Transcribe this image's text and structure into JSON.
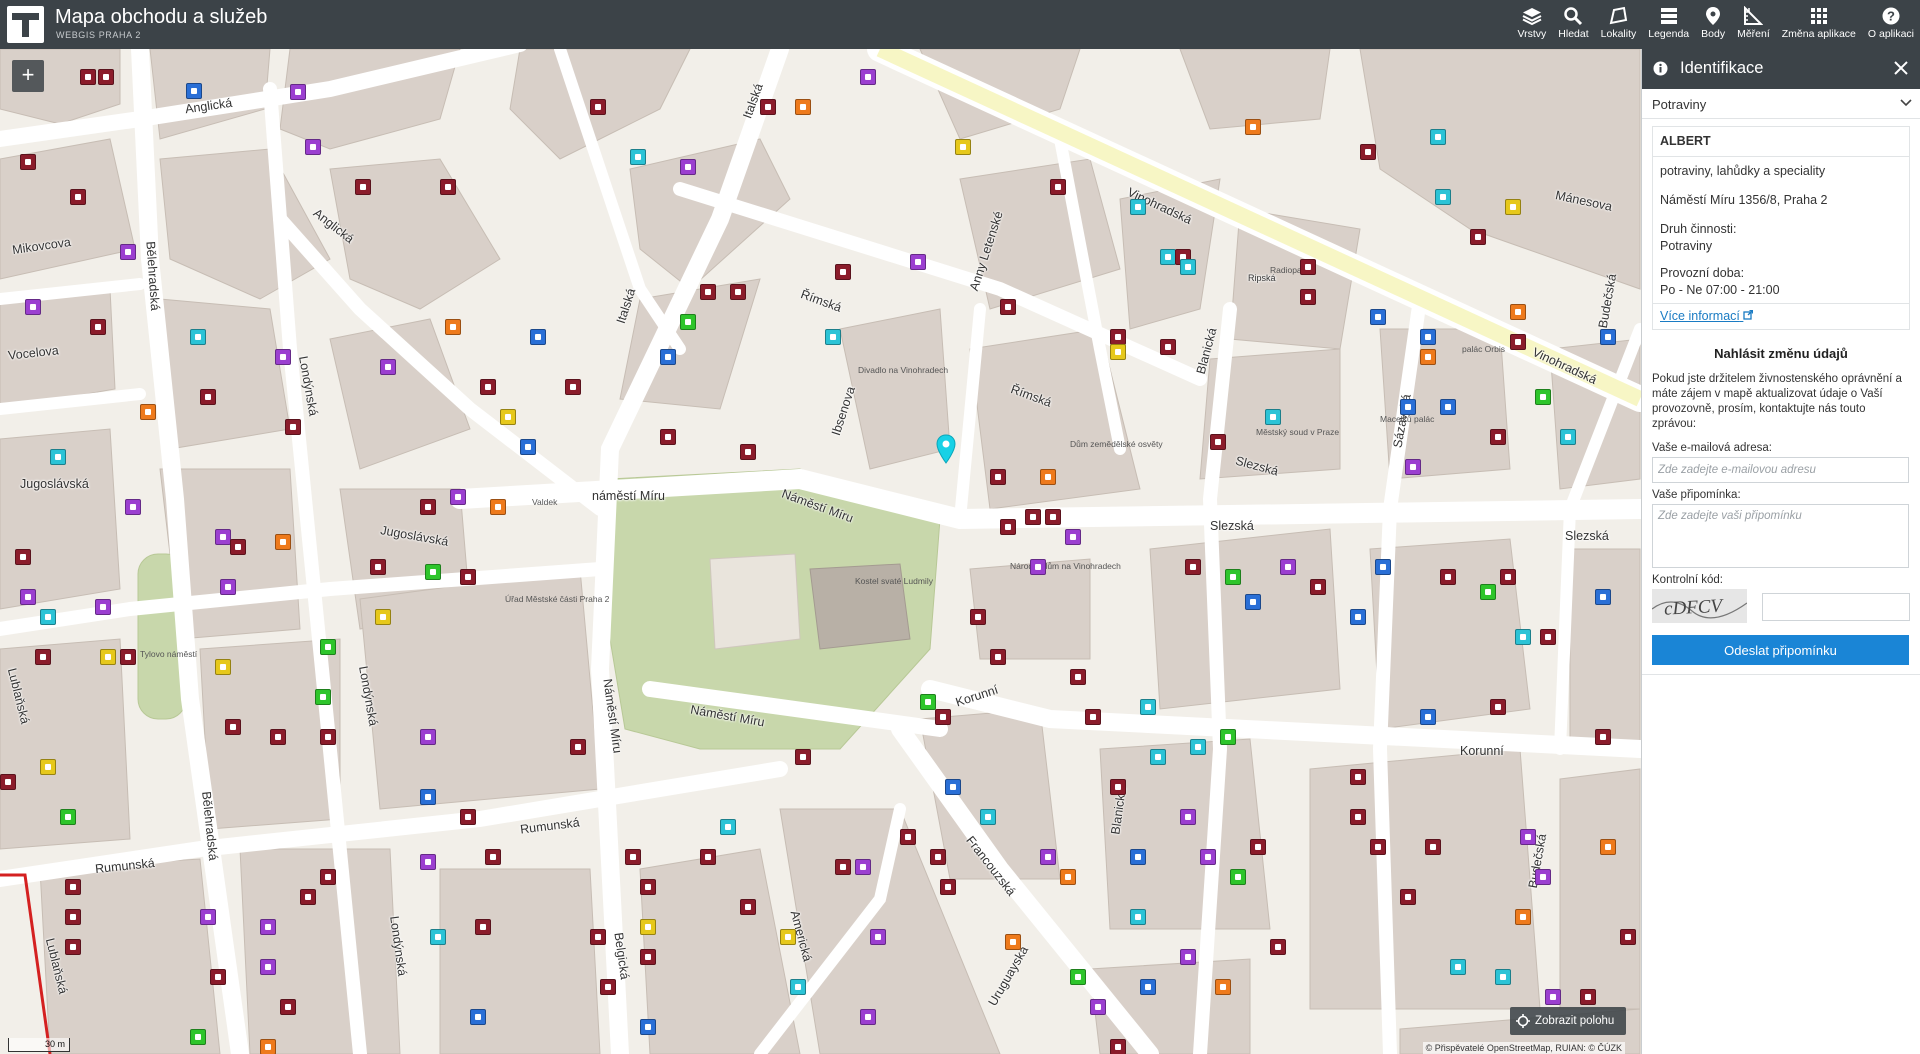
{
  "app": {
    "title": "Mapa obchodu a služeb",
    "subtitle": "WEBGIS PRAHA 2"
  },
  "toolbar": [
    {
      "label": "Vrstvy",
      "icon": "layers-icon"
    },
    {
      "label": "Hledat",
      "icon": "search-icon"
    },
    {
      "label": "Lokality",
      "icon": "area-icon"
    },
    {
      "label": "Legenda",
      "icon": "legend-icon"
    },
    {
      "label": "Body",
      "icon": "point-icon"
    },
    {
      "label": "Měření",
      "icon": "measure-icon"
    },
    {
      "label": "Změna aplikace",
      "icon": "apps-grid-icon"
    },
    {
      "label": "O aplikaci",
      "icon": "help-icon"
    }
  ],
  "map": {
    "zoom_in_label": "+",
    "locate_button": "Zobrazit polohu",
    "attribution": "© Přispěvatelé OpenStreetMap, RUIAN: © ČÚZK",
    "scale": "30 m",
    "street_labels": [
      "Anglická",
      "Anglická",
      "Italská",
      "Italská",
      "Mikovcova",
      "Vocelova",
      "Jugoslávská",
      "Jugoslávská",
      "Londýnská",
      "Londýnská",
      "Londýnská",
      "Bělehradská",
      "Bělehradská",
      "Římská",
      "Římská",
      "Ibsenova",
      "Anny Letenské",
      "Vinohradská",
      "Vinohradská",
      "Blanická",
      "Blanická",
      "Sázavská",
      "Slezská",
      "Slezská",
      "Slezská",
      "náměstí Míru",
      "Náměstí Míru",
      "Náměstí Míru",
      "Náměstí Míru",
      "Korunní",
      "Korunní",
      "Rumunská",
      "Rumunská",
      "Francouzská",
      "Americká",
      "Belgická",
      "Uruguayská",
      "Budečská",
      "Budečská",
      "Mánesova",
      "Lublaňská",
      "Lublaňská",
      "Ripská"
    ],
    "poi_labels": [
      "Divadlo na Vinohradech",
      "Dům zemědělské osvěty",
      "Národní dům na Vinohradech",
      "Kostel svaté Ludmily",
      "Úřad Městské části Praha 2",
      "Tylovo náměstí",
      "Městský soud v Praze",
      "Valdek",
      "palác Orbis",
      "Radiopalác",
      "Macelků palác"
    ]
  },
  "panel": {
    "title": "Identifikace",
    "category": "Potraviny",
    "place": {
      "name": "ALBERT",
      "description": "potraviny, lahůdky a speciality",
      "address": "Náměstí Míru 1356/8, Praha 2",
      "activity_label": "Druh činnosti:",
      "activity_value": "Potraviny",
      "hours_label": "Provozní doba:",
      "hours_value": "Po - Ne 07:00 - 21:00",
      "more_link": "Více informací"
    },
    "report": {
      "title": "Nahlásit změnu údajů",
      "text": "Pokud jste držitelem živnostenského oprávnění a máte zájem v mapě aktualizovat údaje o Vaší provozovně, prosím, kontaktujte nás touto zprávou:",
      "email_label": "Vaše e-mailová adresa:",
      "email_placeholder": "Zde zadejte e-mailovou adresu",
      "note_label": "Vaše připomínka:",
      "note_placeholder": "Zde zadejte vaši připomínku",
      "captcha_label": "Kontrolní kód:",
      "captcha_text": "cDFCV",
      "submit_label": "Odeslat připomínku"
    }
  },
  "colors": {
    "topbar": "#3c4348",
    "accent": "#1a85d6",
    "building": "#d9d0c9",
    "park": "#c8d7ab"
  }
}
